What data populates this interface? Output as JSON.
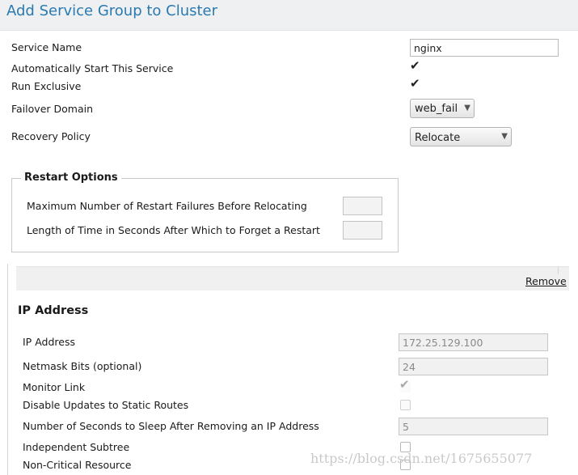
{
  "header": {
    "title": "Add Service Group to Cluster"
  },
  "service": {
    "name_label": "Service Name",
    "name_value": "nginx",
    "autostart_label": "Automatically Start This Service",
    "autostart_checked": true,
    "exclusive_label": "Run Exclusive",
    "exclusive_checked": true,
    "failover_label": "Failover Domain",
    "failover_value": "web_fail",
    "recovery_label": "Recovery Policy",
    "recovery_value": "Relocate"
  },
  "restart_options": {
    "legend": "Restart Options",
    "max_failures_label": "Maximum Number of Restart Failures Before Relocating",
    "max_failures_value": "",
    "forget_label": "Length of Time in Seconds After Which to Forget a Restart",
    "forget_value": ""
  },
  "resource": {
    "remove_label": "Remove",
    "title": "IP Address",
    "ip_label": "IP Address",
    "ip_value": "172.25.129.100",
    "netmask_label": "Netmask Bits (optional)",
    "netmask_value": "24",
    "monitor_label": "Monitor Link",
    "monitor_checked": true,
    "disable_updates_label": "Disable Updates to Static Routes",
    "disable_updates_checked": false,
    "sleep_label": "Number of Seconds to Sleep After Removing an IP Address",
    "sleep_value": "5",
    "independent_label": "Independent Subtree",
    "independent_checked": false,
    "noncritical_label": "Non-Critical Resource",
    "noncritical_checked": false
  },
  "watermark": {
    "text": "https://blog.csdn.net/1675655077"
  }
}
